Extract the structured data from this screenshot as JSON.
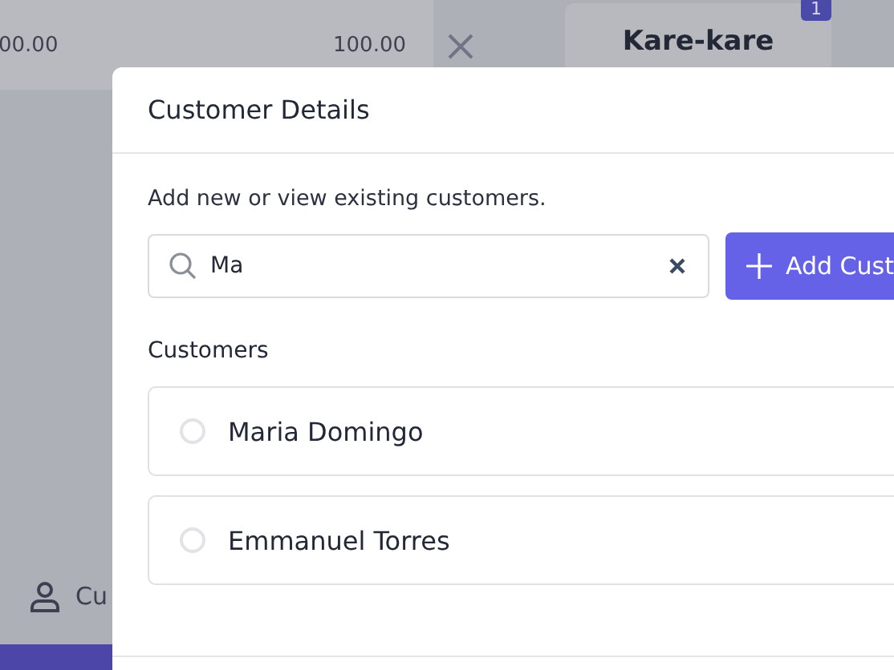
{
  "background": {
    "order_row": {
      "cells": [
        "00.00",
        "100.00"
      ]
    },
    "menu_card": {
      "name": "Kare-kare",
      "badge": "1"
    },
    "sidebar": {
      "items": [
        {
          "label": "Cu",
          "kind": "person"
        }
      ]
    }
  },
  "modal": {
    "title": "Customer Details",
    "subtitle": "Add new or view existing customers.",
    "search": {
      "value": "Ma"
    },
    "add_button": "Add Cust",
    "section_label": "Customers",
    "customers": [
      {
        "name": "Maria Domingo",
        "selected": false
      },
      {
        "name": "Emmanuel Torres",
        "selected": false
      }
    ]
  }
}
